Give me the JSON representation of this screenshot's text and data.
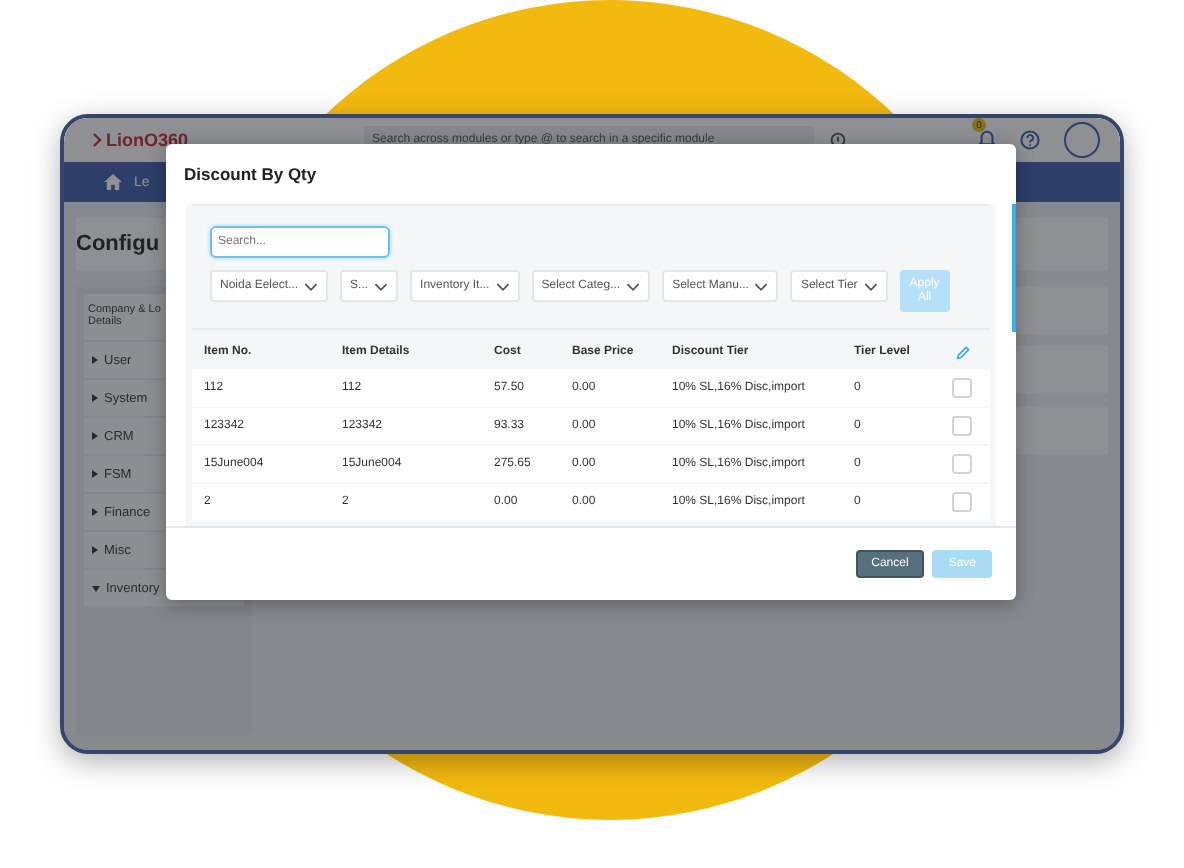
{
  "app": {
    "logo": "LionO360",
    "search_placeholder": "Search across modules or type @ to search in a specific module",
    "notification_count": "0",
    "nav_items": [
      "Le"
    ],
    "page_title": "Configu",
    "sidebar": {
      "heading_lines": [
        "Company & Lo",
        "Details"
      ],
      "items": [
        {
          "label": "User",
          "expanded": false
        },
        {
          "label": "System",
          "expanded": false
        },
        {
          "label": "CRM",
          "expanded": false
        },
        {
          "label": "FSM",
          "expanded": false
        },
        {
          "label": "Finance",
          "expanded": false
        },
        {
          "label": "Misc",
          "expanded": false
        },
        {
          "label": "Inventory",
          "expanded": true
        }
      ]
    }
  },
  "modal": {
    "title": "Discount By Qty",
    "search": {
      "placeholder": "Search...",
      "focused": true
    },
    "filters": [
      {
        "label": "Noida Eelect..."
      },
      {
        "label": "S..."
      },
      {
        "label": "Inventory It..."
      },
      {
        "label": "Select Categ..."
      },
      {
        "label": "Select Manu..."
      },
      {
        "label": "Select Tier"
      }
    ],
    "apply_button": {
      "label": "Apply All",
      "disabled": true
    },
    "table": {
      "columns": [
        "Item No.",
        "Item Details",
        "Cost",
        "Base Price",
        "Discount Tier",
        "Tier Level"
      ],
      "rows": [
        {
          "cells": [
            "112",
            "112",
            "57.50",
            "0.00",
            "10% SL,16% Disc,import",
            "0"
          ],
          "checked": false
        },
        {
          "cells": [
            "123342",
            "123342",
            "93.33",
            "0.00",
            "10% SL,16% Disc,import",
            "0"
          ],
          "checked": false
        },
        {
          "cells": [
            "15June004",
            "15June004",
            "275.65",
            "0.00",
            "10% SL,16% Disc,import",
            "0"
          ],
          "checked": false
        },
        {
          "cells": [
            "2",
            "2",
            "0.00",
            "0.00",
            "10% SL,16% Disc,import",
            "0"
          ],
          "checked": false
        }
      ]
    },
    "buttons": [
      {
        "label": "Cancel",
        "kind": "secondary",
        "disabled": false
      },
      {
        "label": "Save",
        "kind": "primary",
        "disabled": true
      }
    ]
  }
}
